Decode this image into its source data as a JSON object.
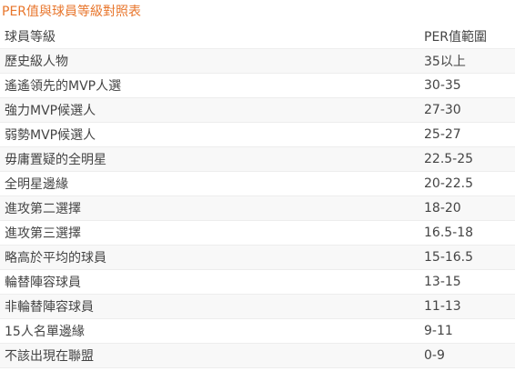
{
  "title": "PER值與球員等級對照表",
  "table": {
    "headers": {
      "tier": "球員等級",
      "per": "PER值範圍"
    },
    "rows": [
      {
        "tier": "歷史級人物",
        "per": "35以上"
      },
      {
        "tier": "遙遙領先的MVP人選",
        "per": "30-35"
      },
      {
        "tier": "強力MVP候選人",
        "per": "27-30"
      },
      {
        "tier": "弱勢MVP候選人",
        "per": "25-27"
      },
      {
        "tier": "毋庸置疑的全明星",
        "per": "22.5-25"
      },
      {
        "tier": "全明星邊緣",
        "per": "20-22.5"
      },
      {
        "tier": "進攻第二選擇",
        "per": "18-20"
      },
      {
        "tier": "進攻第三選擇",
        "per": "16.5-18"
      },
      {
        "tier": "略高於平均的球員",
        "per": "15-16.5"
      },
      {
        "tier": "輪替陣容球員",
        "per": "13-15"
      },
      {
        "tier": "非輪替陣容球員",
        "per": "11-13"
      },
      {
        "tier": "15人名單邊緣",
        "per": "9-11"
      },
      {
        "tier": "不該出現在聯盟",
        "per": "0-9"
      }
    ]
  }
}
